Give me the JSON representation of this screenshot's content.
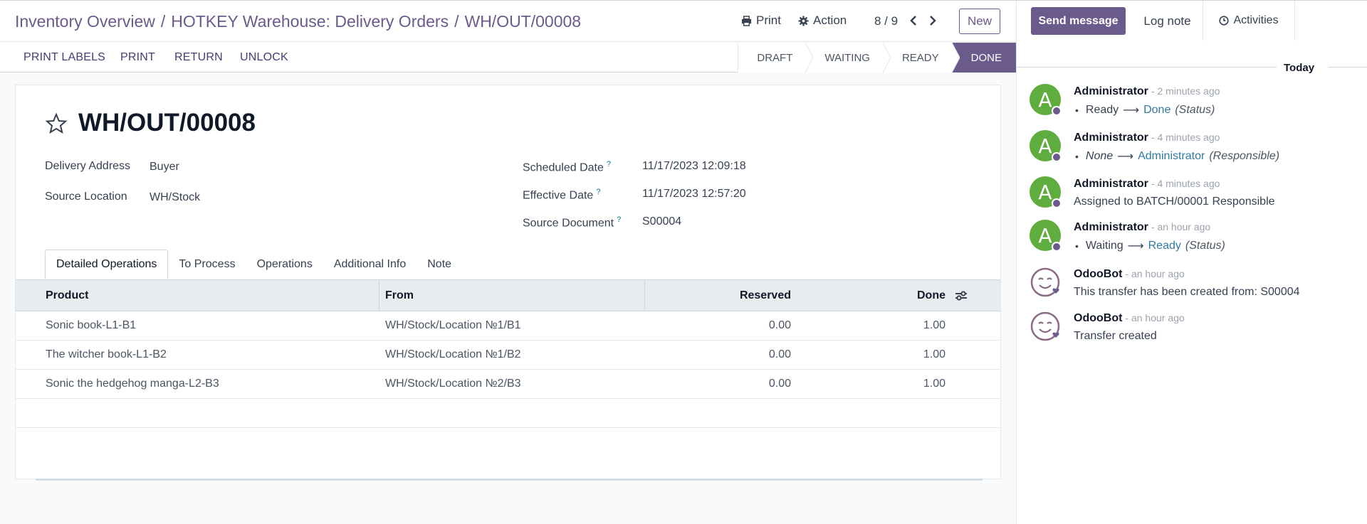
{
  "breadcrumb": {
    "items": [
      "Inventory Overview",
      "HOTKEY Warehouse: Delivery Orders"
    ],
    "current": "WH/OUT/00008",
    "separator": "/"
  },
  "header": {
    "print_label": "Print",
    "action_label": "Action",
    "pager": "8 / 9",
    "new_label": "New"
  },
  "actions": [
    "PRINT LABELS",
    "PRINT",
    "RETURN",
    "UNLOCK"
  ],
  "stages": [
    {
      "label": "DRAFT",
      "active": false
    },
    {
      "label": "WAITING",
      "active": false
    },
    {
      "label": "READY",
      "active": false
    },
    {
      "label": "DONE",
      "active": true
    }
  ],
  "record": {
    "title": "WH/OUT/00008",
    "fields_left": [
      {
        "label": "Delivery Address",
        "value": "Buyer"
      },
      {
        "label": "Source Location",
        "value": "WH/Stock"
      }
    ],
    "fields_right": [
      {
        "label": "Scheduled Date",
        "help": "?",
        "value": "11/17/2023 12:09:18"
      },
      {
        "label": "Effective Date",
        "help": "?",
        "value": "11/17/2023 12:57:20"
      },
      {
        "label": "Source Document",
        "help": "?",
        "value": "S00004"
      }
    ]
  },
  "tabs": [
    "Detailed Operations",
    "To Process",
    "Operations",
    "Additional Info",
    "Note"
  ],
  "active_tab": "Detailed Operations",
  "table": {
    "headers": {
      "product": "Product",
      "from": "From",
      "reserved": "Reserved",
      "done": "Done"
    },
    "rows": [
      {
        "product": "Sonic book-L1-B1",
        "from": "WH/Stock/Location №1/B1",
        "reserved": "0.00",
        "done": "1.00"
      },
      {
        "product": "The witcher book-L1-B2",
        "from": "WH/Stock/Location №1/B2",
        "reserved": "0.00",
        "done": "1.00"
      },
      {
        "product": "Sonic the hedgehog manga-L2-B3",
        "from": "WH/Stock/Location №2/B3",
        "reserved": "0.00",
        "done": "1.00"
      }
    ]
  },
  "chatter": {
    "send_message": "Send message",
    "log_note": "Log note",
    "activities": "Activities",
    "day": "Today",
    "messages": [
      {
        "author": "Administrator",
        "time": "- 2 minutes ago",
        "avatar_letter": "A",
        "old": "Ready",
        "new": "Done",
        "field": "(Status)"
      },
      {
        "author": "Administrator",
        "time": "- 4 minutes ago",
        "avatar_letter": "A",
        "old": "None",
        "new": "Administrator",
        "field": "(Responsible)"
      },
      {
        "author": "Administrator",
        "time": "- 4 minutes ago",
        "avatar_letter": "A",
        "text": "Assigned to BATCH/00001 Responsible"
      },
      {
        "author": "Administrator",
        "time": "- an hour ago",
        "avatar_letter": "A",
        "old": "Waiting",
        "new": "Ready",
        "field": "(Status)"
      },
      {
        "author": "OdooBot",
        "time": "- an hour ago",
        "text": "This transfer has been created from: S00004"
      },
      {
        "author": "OdooBot",
        "time": "- an hour ago",
        "text": "Transfer created"
      }
    ]
  },
  "colors": {
    "brand": "#6b5a8c",
    "avatar_green": "#5fad3f",
    "link_blue": "#2f7aa3",
    "help_teal": "#017e84"
  }
}
